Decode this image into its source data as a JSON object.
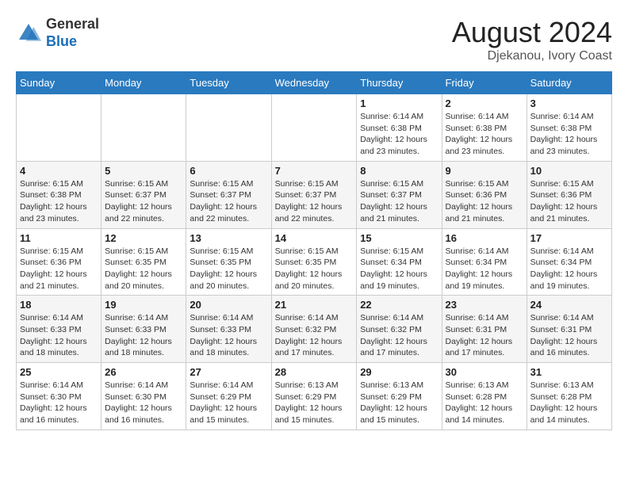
{
  "header": {
    "logo_general": "General",
    "logo_blue": "Blue",
    "month_title": "August 2024",
    "location": "Djekanou, Ivory Coast"
  },
  "weekdays": [
    "Sunday",
    "Monday",
    "Tuesday",
    "Wednesday",
    "Thursday",
    "Friday",
    "Saturday"
  ],
  "weeks": [
    [
      {
        "day": "",
        "sunrise": "",
        "sunset": "",
        "daylight": ""
      },
      {
        "day": "",
        "sunrise": "",
        "sunset": "",
        "daylight": ""
      },
      {
        "day": "",
        "sunrise": "",
        "sunset": "",
        "daylight": ""
      },
      {
        "day": "",
        "sunrise": "",
        "sunset": "",
        "daylight": ""
      },
      {
        "day": "1",
        "sunrise": "Sunrise: 6:14 AM",
        "sunset": "Sunset: 6:38 PM",
        "daylight": "Daylight: 12 hours and 23 minutes."
      },
      {
        "day": "2",
        "sunrise": "Sunrise: 6:14 AM",
        "sunset": "Sunset: 6:38 PM",
        "daylight": "Daylight: 12 hours and 23 minutes."
      },
      {
        "day": "3",
        "sunrise": "Sunrise: 6:14 AM",
        "sunset": "Sunset: 6:38 PM",
        "daylight": "Daylight: 12 hours and 23 minutes."
      }
    ],
    [
      {
        "day": "4",
        "sunrise": "Sunrise: 6:15 AM",
        "sunset": "Sunset: 6:38 PM",
        "daylight": "Daylight: 12 hours and 23 minutes."
      },
      {
        "day": "5",
        "sunrise": "Sunrise: 6:15 AM",
        "sunset": "Sunset: 6:37 PM",
        "daylight": "Daylight: 12 hours and 22 minutes."
      },
      {
        "day": "6",
        "sunrise": "Sunrise: 6:15 AM",
        "sunset": "Sunset: 6:37 PM",
        "daylight": "Daylight: 12 hours and 22 minutes."
      },
      {
        "day": "7",
        "sunrise": "Sunrise: 6:15 AM",
        "sunset": "Sunset: 6:37 PM",
        "daylight": "Daylight: 12 hours and 22 minutes."
      },
      {
        "day": "8",
        "sunrise": "Sunrise: 6:15 AM",
        "sunset": "Sunset: 6:37 PM",
        "daylight": "Daylight: 12 hours and 21 minutes."
      },
      {
        "day": "9",
        "sunrise": "Sunrise: 6:15 AM",
        "sunset": "Sunset: 6:36 PM",
        "daylight": "Daylight: 12 hours and 21 minutes."
      },
      {
        "day": "10",
        "sunrise": "Sunrise: 6:15 AM",
        "sunset": "Sunset: 6:36 PM",
        "daylight": "Daylight: 12 hours and 21 minutes."
      }
    ],
    [
      {
        "day": "11",
        "sunrise": "Sunrise: 6:15 AM",
        "sunset": "Sunset: 6:36 PM",
        "daylight": "Daylight: 12 hours and 21 minutes."
      },
      {
        "day": "12",
        "sunrise": "Sunrise: 6:15 AM",
        "sunset": "Sunset: 6:35 PM",
        "daylight": "Daylight: 12 hours and 20 minutes."
      },
      {
        "day": "13",
        "sunrise": "Sunrise: 6:15 AM",
        "sunset": "Sunset: 6:35 PM",
        "daylight": "Daylight: 12 hours and 20 minutes."
      },
      {
        "day": "14",
        "sunrise": "Sunrise: 6:15 AM",
        "sunset": "Sunset: 6:35 PM",
        "daylight": "Daylight: 12 hours and 20 minutes."
      },
      {
        "day": "15",
        "sunrise": "Sunrise: 6:15 AM",
        "sunset": "Sunset: 6:34 PM",
        "daylight": "Daylight: 12 hours and 19 minutes."
      },
      {
        "day": "16",
        "sunrise": "Sunrise: 6:14 AM",
        "sunset": "Sunset: 6:34 PM",
        "daylight": "Daylight: 12 hours and 19 minutes."
      },
      {
        "day": "17",
        "sunrise": "Sunrise: 6:14 AM",
        "sunset": "Sunset: 6:34 PM",
        "daylight": "Daylight: 12 hours and 19 minutes."
      }
    ],
    [
      {
        "day": "18",
        "sunrise": "Sunrise: 6:14 AM",
        "sunset": "Sunset: 6:33 PM",
        "daylight": "Daylight: 12 hours and 18 minutes."
      },
      {
        "day": "19",
        "sunrise": "Sunrise: 6:14 AM",
        "sunset": "Sunset: 6:33 PM",
        "daylight": "Daylight: 12 hours and 18 minutes."
      },
      {
        "day": "20",
        "sunrise": "Sunrise: 6:14 AM",
        "sunset": "Sunset: 6:33 PM",
        "daylight": "Daylight: 12 hours and 18 minutes."
      },
      {
        "day": "21",
        "sunrise": "Sunrise: 6:14 AM",
        "sunset": "Sunset: 6:32 PM",
        "daylight": "Daylight: 12 hours and 17 minutes."
      },
      {
        "day": "22",
        "sunrise": "Sunrise: 6:14 AM",
        "sunset": "Sunset: 6:32 PM",
        "daylight": "Daylight: 12 hours and 17 minutes."
      },
      {
        "day": "23",
        "sunrise": "Sunrise: 6:14 AM",
        "sunset": "Sunset: 6:31 PM",
        "daylight": "Daylight: 12 hours and 17 minutes."
      },
      {
        "day": "24",
        "sunrise": "Sunrise: 6:14 AM",
        "sunset": "Sunset: 6:31 PM",
        "daylight": "Daylight: 12 hours and 16 minutes."
      }
    ],
    [
      {
        "day": "25",
        "sunrise": "Sunrise: 6:14 AM",
        "sunset": "Sunset: 6:30 PM",
        "daylight": "Daylight: 12 hours and 16 minutes."
      },
      {
        "day": "26",
        "sunrise": "Sunrise: 6:14 AM",
        "sunset": "Sunset: 6:30 PM",
        "daylight": "Daylight: 12 hours and 16 minutes."
      },
      {
        "day": "27",
        "sunrise": "Sunrise: 6:14 AM",
        "sunset": "Sunset: 6:29 PM",
        "daylight": "Daylight: 12 hours and 15 minutes."
      },
      {
        "day": "28",
        "sunrise": "Sunrise: 6:13 AM",
        "sunset": "Sunset: 6:29 PM",
        "daylight": "Daylight: 12 hours and 15 minutes."
      },
      {
        "day": "29",
        "sunrise": "Sunrise: 6:13 AM",
        "sunset": "Sunset: 6:29 PM",
        "daylight": "Daylight: 12 hours and 15 minutes."
      },
      {
        "day": "30",
        "sunrise": "Sunrise: 6:13 AM",
        "sunset": "Sunset: 6:28 PM",
        "daylight": "Daylight: 12 hours and 14 minutes."
      },
      {
        "day": "31",
        "sunrise": "Sunrise: 6:13 AM",
        "sunset": "Sunset: 6:28 PM",
        "daylight": "Daylight: 12 hours and 14 minutes."
      }
    ]
  ]
}
